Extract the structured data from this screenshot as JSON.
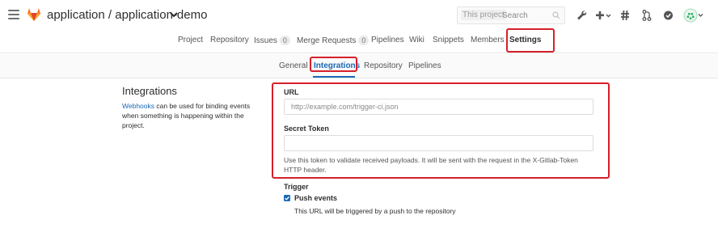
{
  "header": {
    "project_title": "application / application-demo",
    "search": {
      "scope_label": "This project",
      "placeholder": "Search"
    }
  },
  "project_nav": {
    "items": [
      {
        "label": "Project"
      },
      {
        "label": "Repository"
      },
      {
        "label": "Issues",
        "count": "0"
      },
      {
        "label": "Merge Requests",
        "count": "0"
      },
      {
        "label": "Pipelines"
      },
      {
        "label": "Wiki"
      },
      {
        "label": "Snippets"
      },
      {
        "label": "Members"
      },
      {
        "label": "Settings",
        "active": true
      }
    ]
  },
  "sub_nav": {
    "items": [
      {
        "label": "General"
      },
      {
        "label": "Integrations",
        "active": true
      },
      {
        "label": "Repository"
      },
      {
        "label": "Pipelines"
      }
    ]
  },
  "section": {
    "title": "Integrations",
    "description_link": "Webhooks",
    "description_text": " can be used for binding events when something is happening within the project."
  },
  "form": {
    "url_label": "URL",
    "url_placeholder": "http://example.com/trigger-ci.json",
    "secret_label": "Secret Token",
    "secret_value": "",
    "secret_help": "Use this token to validate received payloads. It will be sent with the request in the X-Gitlab-Token HTTP header.",
    "trigger_label": "Trigger",
    "push_events_label": "Push events",
    "push_events_checked": true,
    "push_events_help": "This URL will be triggered by a push to the repository"
  },
  "colors": {
    "accent": "#1b69b6",
    "highlight": "#d6202a",
    "logo": "#fc6d26"
  },
  "icons": {
    "menu": "hamburger-icon",
    "logo": "gitlab-fox-logo",
    "caret": "chevron-down-icon",
    "search": "search-icon",
    "admin": "wrench-icon",
    "new": "plus-icon",
    "todos": "hash-icon",
    "merge_requests": "merge-request-icon",
    "issues": "check-circle-icon",
    "avatar": "user-avatar"
  }
}
